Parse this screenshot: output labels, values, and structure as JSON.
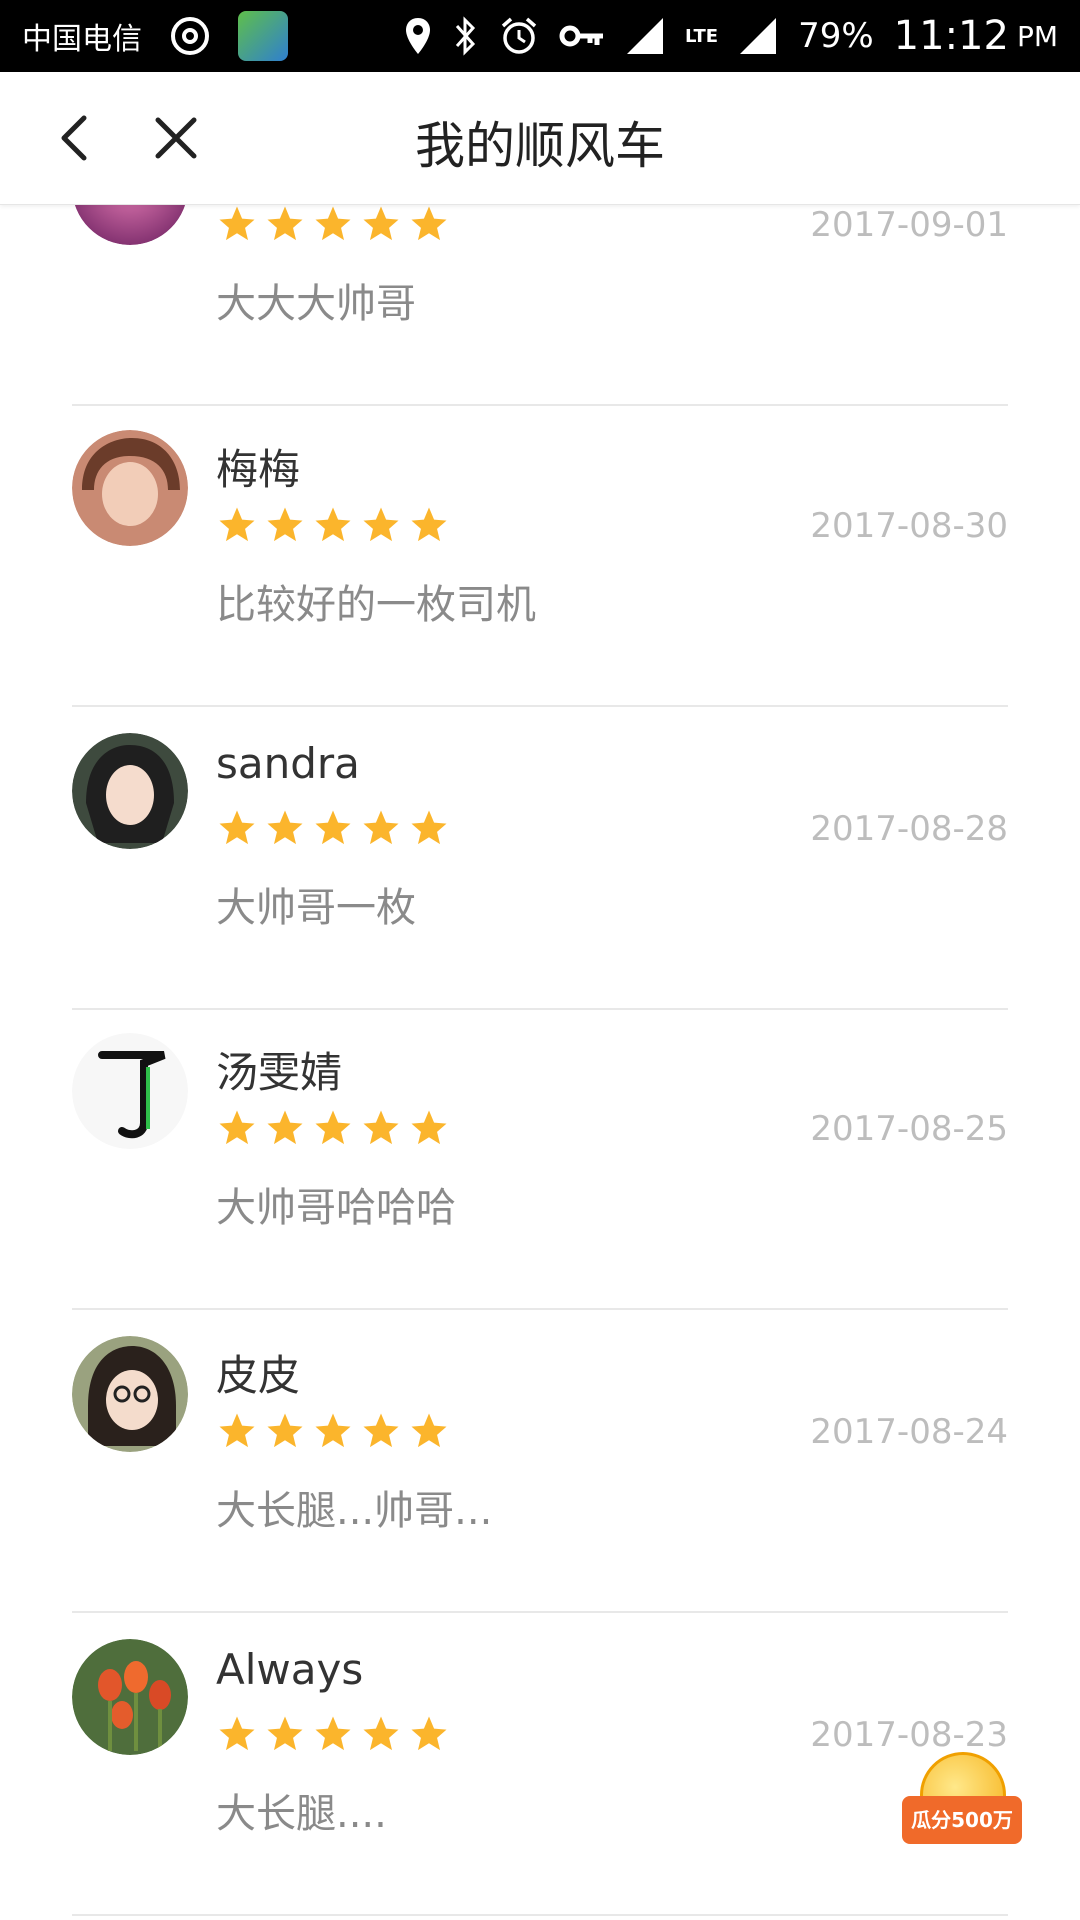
{
  "status_bar": {
    "carrier": "中国电信",
    "battery": "79%",
    "time": "11:12",
    "ampm": "PM",
    "network": "LTE"
  },
  "header": {
    "title": "我的顺风车",
    "back_icon": "chevron-left-icon",
    "close_icon": "close-icon"
  },
  "colors": {
    "star": "#FBB52C",
    "date": "#BDBDBD",
    "comment": "#8A8A8A",
    "name": "#333333"
  },
  "reviews": [
    {
      "name": "",
      "rating": 5,
      "date": "2017-09-01",
      "comment": "大大大帅哥"
    },
    {
      "name": "梅梅",
      "rating": 5,
      "date": "2017-08-30",
      "comment": "比较好的一枚司机"
    },
    {
      "name": "sandra",
      "rating": 5,
      "date": "2017-08-28",
      "comment": "大帅哥一枚"
    },
    {
      "name": "汤雯婧",
      "rating": 5,
      "date": "2017-08-25",
      "comment": "大帅哥哈哈哈"
    },
    {
      "name": "皮皮",
      "rating": 5,
      "date": "2017-08-24",
      "comment": "大长腿...帅哥..."
    },
    {
      "name": "Always",
      "rating": 5,
      "date": "2017-08-23",
      "comment": "大长腿...."
    }
  ],
  "promo": {
    "label": "瓜分500万"
  }
}
